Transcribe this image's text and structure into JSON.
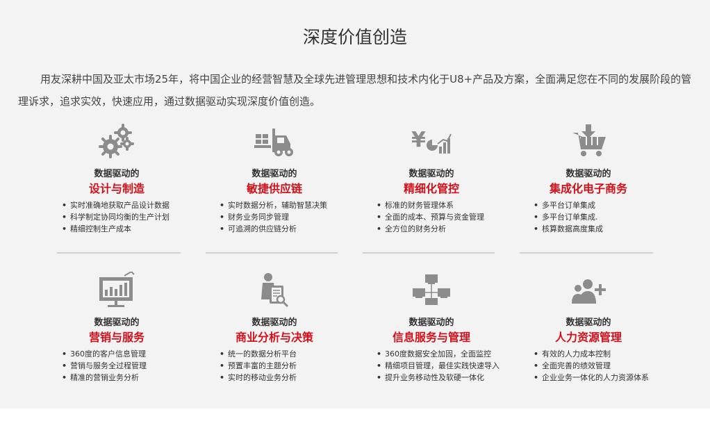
{
  "section": {
    "title": "深度价值创造",
    "intro": "用友深耕中国及亚太市场25年，将中国企业的经营智慧及全球先进管理思想和技术内化于U8+产品及方案，全面满足您在不同的发展阶段的管理诉求，追求实效，快速应用，通过数据驱动实现深度价值创造。"
  },
  "colors": {
    "accent": "#d4101a",
    "background": "#f3f3f3",
    "icon": "#8c8c8c",
    "divider": "#cfcfcf"
  },
  "cards": [
    {
      "icon": "gears-icon",
      "kicker": "数据驱动的",
      "heading": "设计与制造",
      "items": [
        "实时准确地获取产品设计数据",
        "科学制定协同均衡的生产计划",
        "精细控制生产成本"
      ]
    },
    {
      "icon": "forklift-icon",
      "kicker": "数据驱动的",
      "heading": "敏捷供应链",
      "items": [
        "实时数据分析，辅助智慧决策",
        "财务业务同步管理",
        "可追溯的供应链分析"
      ]
    },
    {
      "icon": "finance-chart-icon",
      "kicker": "数据驱动的",
      "heading": "精细化管控",
      "items": [
        "标准的财务管理体系",
        "全面的成本、预算与资金管理",
        "全方位的财务分析"
      ]
    },
    {
      "icon": "shopping-cart-icon",
      "kicker": "数据驱动的",
      "heading": "集成化电子商务",
      "items": [
        "多平台订单集成",
        "多平台订单集成.",
        "核算数据高度集成"
      ]
    },
    {
      "icon": "billboard-chart-icon",
      "kicker": "数据驱动的",
      "heading": "营销与服务",
      "items": [
        "360度的客户信息管理",
        "营销与服务全过程管理",
        "精准的营销业务分析"
      ]
    },
    {
      "icon": "analyst-icon",
      "kicker": "数据驱动的",
      "heading": "商业分析与决策",
      "items": [
        "统一的数据分析平台",
        "预置丰富的主题分析",
        "实时的移动业务分析"
      ]
    },
    {
      "icon": "network-computers-icon",
      "kicker": "数据驱动的",
      "heading": "信息服务与管理",
      "items": [
        "360度数据安全加固，全面监控",
        "精细项目管理，最佳实践快速导入",
        "提升业务移动性及软硬一体化"
      ]
    },
    {
      "icon": "add-people-icon",
      "kicker": "数据驱动的",
      "heading": "人力资源管理",
      "items": [
        "有效的人力成本控制",
        "全面完善的绩效管理",
        "企业业务一体化的人力资源体系"
      ]
    }
  ]
}
